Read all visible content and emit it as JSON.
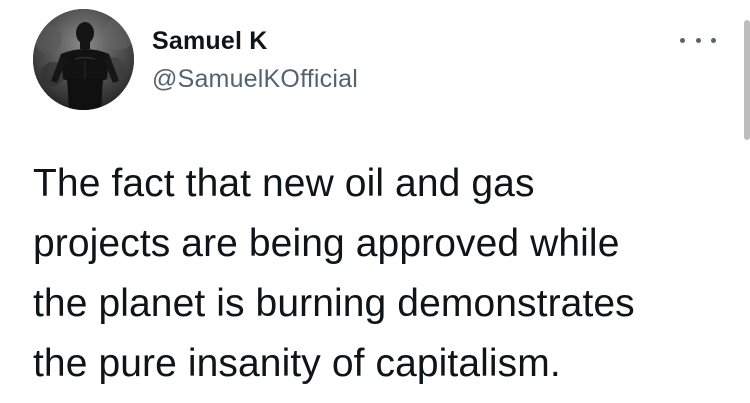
{
  "author": {
    "display_name": "Samuel K",
    "handle": "@SamuelKOfficial",
    "avatar_icon": "profile-photo"
  },
  "menu": {
    "icon": "more-horizontal-icon"
  },
  "tweet": {
    "lines": [
      "The fact that new oil and gas",
      "projects are being approved while",
      "the planet is burning demonstrates",
      "the pure insanity of capitalism."
    ]
  },
  "colors": {
    "text": "#0f1419",
    "secondary": "#536471",
    "background": "#ffffff"
  }
}
